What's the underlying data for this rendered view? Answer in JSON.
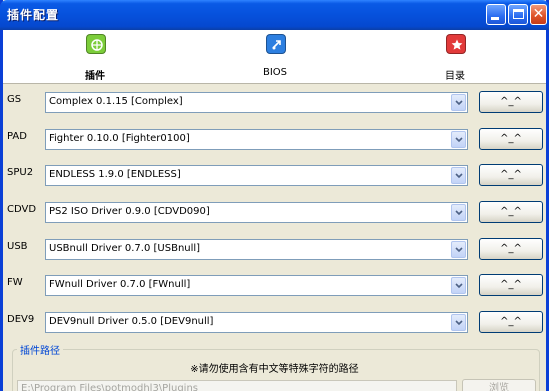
{
  "window": {
    "title": "插件配置",
    "controls": {
      "minimize": "minimize",
      "maximize": "maximize",
      "close": "✕"
    }
  },
  "toolbar": {
    "items": [
      {
        "label": "插件",
        "icon": "puzzle-icon",
        "color": "#7ccd3a",
        "selected": true
      },
      {
        "label": "BIOS",
        "icon": "bios-chip-icon",
        "color": "#2d7fe0",
        "selected": false
      },
      {
        "label": "目录",
        "icon": "star-icon",
        "color": "#e23a3a",
        "selected": false
      }
    ]
  },
  "plugins": [
    {
      "label": "GS",
      "value": "Complex 0.1.15 [Complex]",
      "button": "^_^"
    },
    {
      "label": "PAD",
      "value": "Fighter 0.10.0 [Fighter0100]",
      "button": "^_^"
    },
    {
      "label": "SPU2",
      "value": "ENDLESS 1.9.0 [ENDLESS]",
      "button": "^_^"
    },
    {
      "label": "CDVD",
      "value": "PS2 ISO Driver 0.9.0 [CDVD090]",
      "button": "^_^"
    },
    {
      "label": "USB",
      "value": "USBnull Driver 0.7.0 [USBnull]",
      "button": "^_^"
    },
    {
      "label": "FW",
      "value": "FWnull Driver 0.7.0 [FWnull]",
      "button": "^_^"
    },
    {
      "label": "DEV9",
      "value": "DEV9null Driver 0.5.0 [DEV9null]",
      "button": "^_^"
    }
  ],
  "plugin_path": {
    "title": "插件路径",
    "warning": "※请勿使用含有中文等特殊字符的路径",
    "path": "E:\\Program Files\\potmodhl3\\Plugins",
    "browse": "浏览"
  }
}
